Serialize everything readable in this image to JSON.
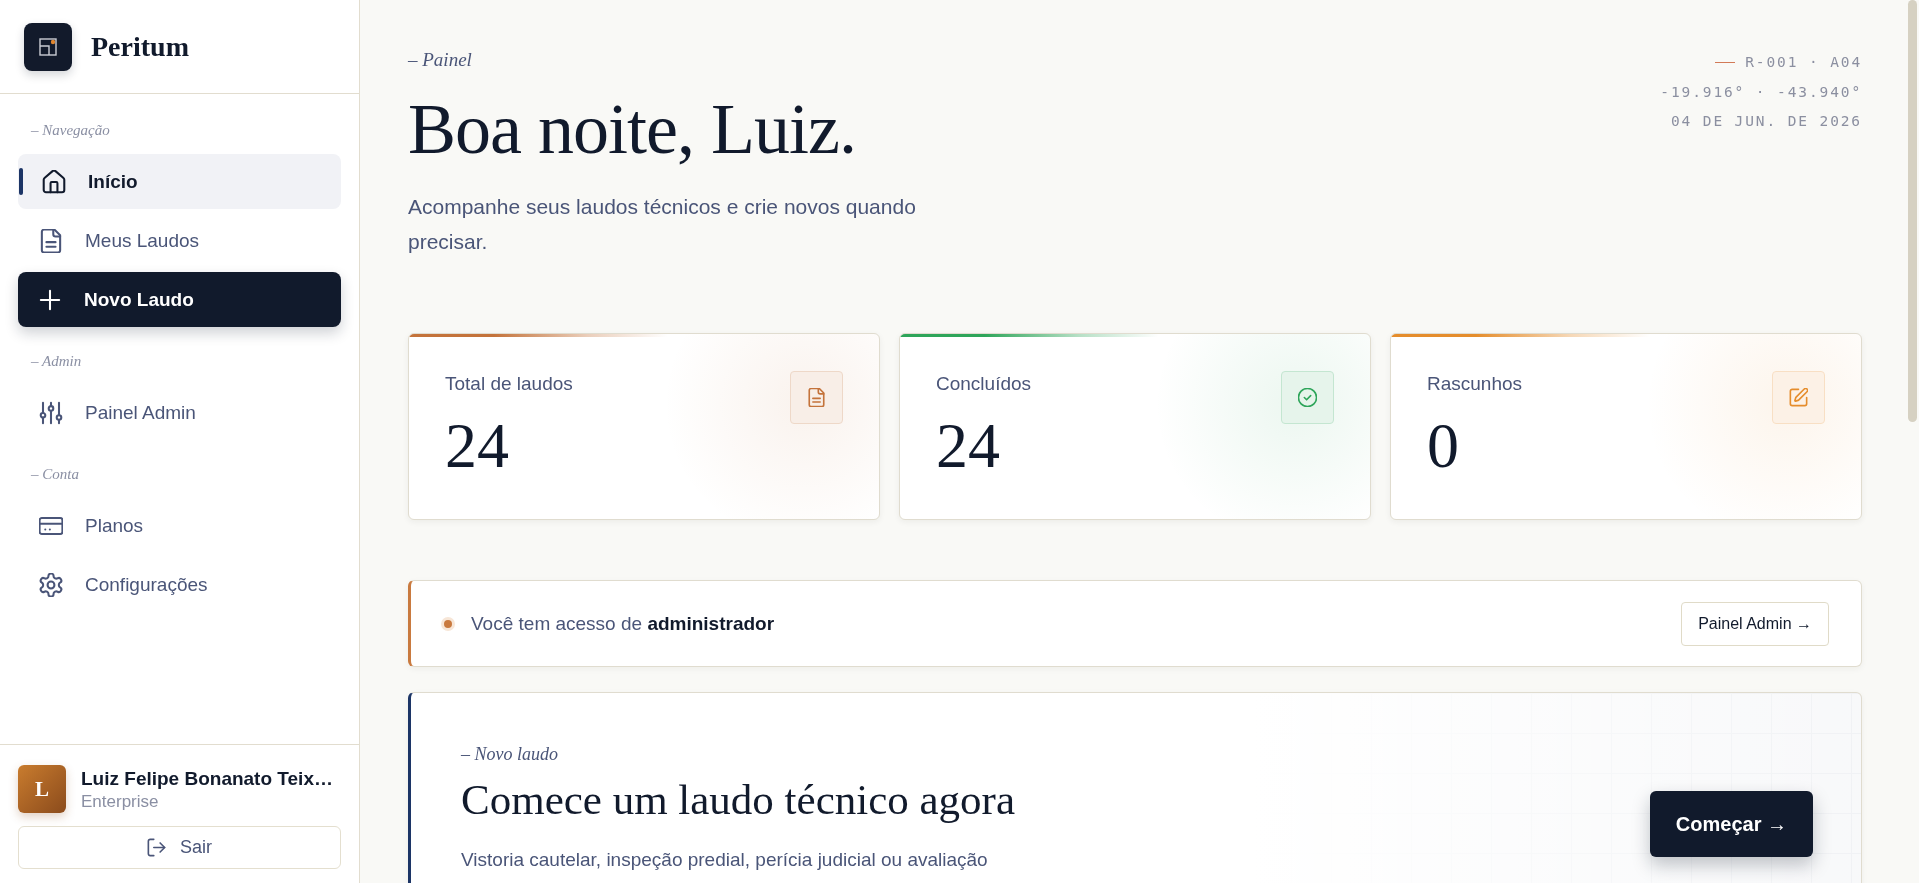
{
  "sidebar": {
    "brand": {
      "name": "Peritum"
    },
    "sections": [
      {
        "label": "– Navegação",
        "items": [
          {
            "label": "Início",
            "kind": "link",
            "selected": true
          },
          {
            "label": "Meus Laudos",
            "kind": "link",
            "selected": false
          },
          {
            "label": "Novo Laudo",
            "kind": "primary",
            "selected": false
          }
        ]
      },
      {
        "label": "– Admin",
        "items": [
          {
            "label": "Painel Admin",
            "kind": "link",
            "selected": false
          }
        ]
      },
      {
        "label": "– Conta",
        "items": [
          {
            "label": "Planos",
            "kind": "link",
            "selected": false
          },
          {
            "label": "Configurações",
            "kind": "link",
            "selected": false
          }
        ]
      }
    ],
    "user": {
      "initial": "L",
      "name": "Luiz Felipe Bonanato Teix…",
      "plan": "Enterprise"
    },
    "logout": {
      "label": "Sair"
    }
  },
  "header": {
    "eyebrow": "– Painel",
    "title": "Boa noite, Luiz.",
    "subtitle": "Acompanhe seus laudos técnicos e crie novos quando precisar.",
    "meta": [
      "R-001 · A04",
      "-19.916° · -43.940°",
      "04 DE JUN. DE 2026"
    ]
  },
  "stats": [
    {
      "label": "Total de laudos",
      "value": "24",
      "color": "#c4733b"
    },
    {
      "label": "Concluídos",
      "value": "24",
      "color": "#2ea55a"
    },
    {
      "label": "Rascunhos",
      "value": "0",
      "color": "#e58d2c"
    }
  ],
  "admin_banner": {
    "text": "Você tem acesso de **administrador**",
    "button": "Painel Admin →"
  },
  "new_report": {
    "eyebrow": "– Novo laudo",
    "title": "Comece um laudo técnico agora",
    "description": "Vistoria cautelar, inspeção predial, perícia judicial ou avaliação",
    "button": "Começar →"
  }
}
